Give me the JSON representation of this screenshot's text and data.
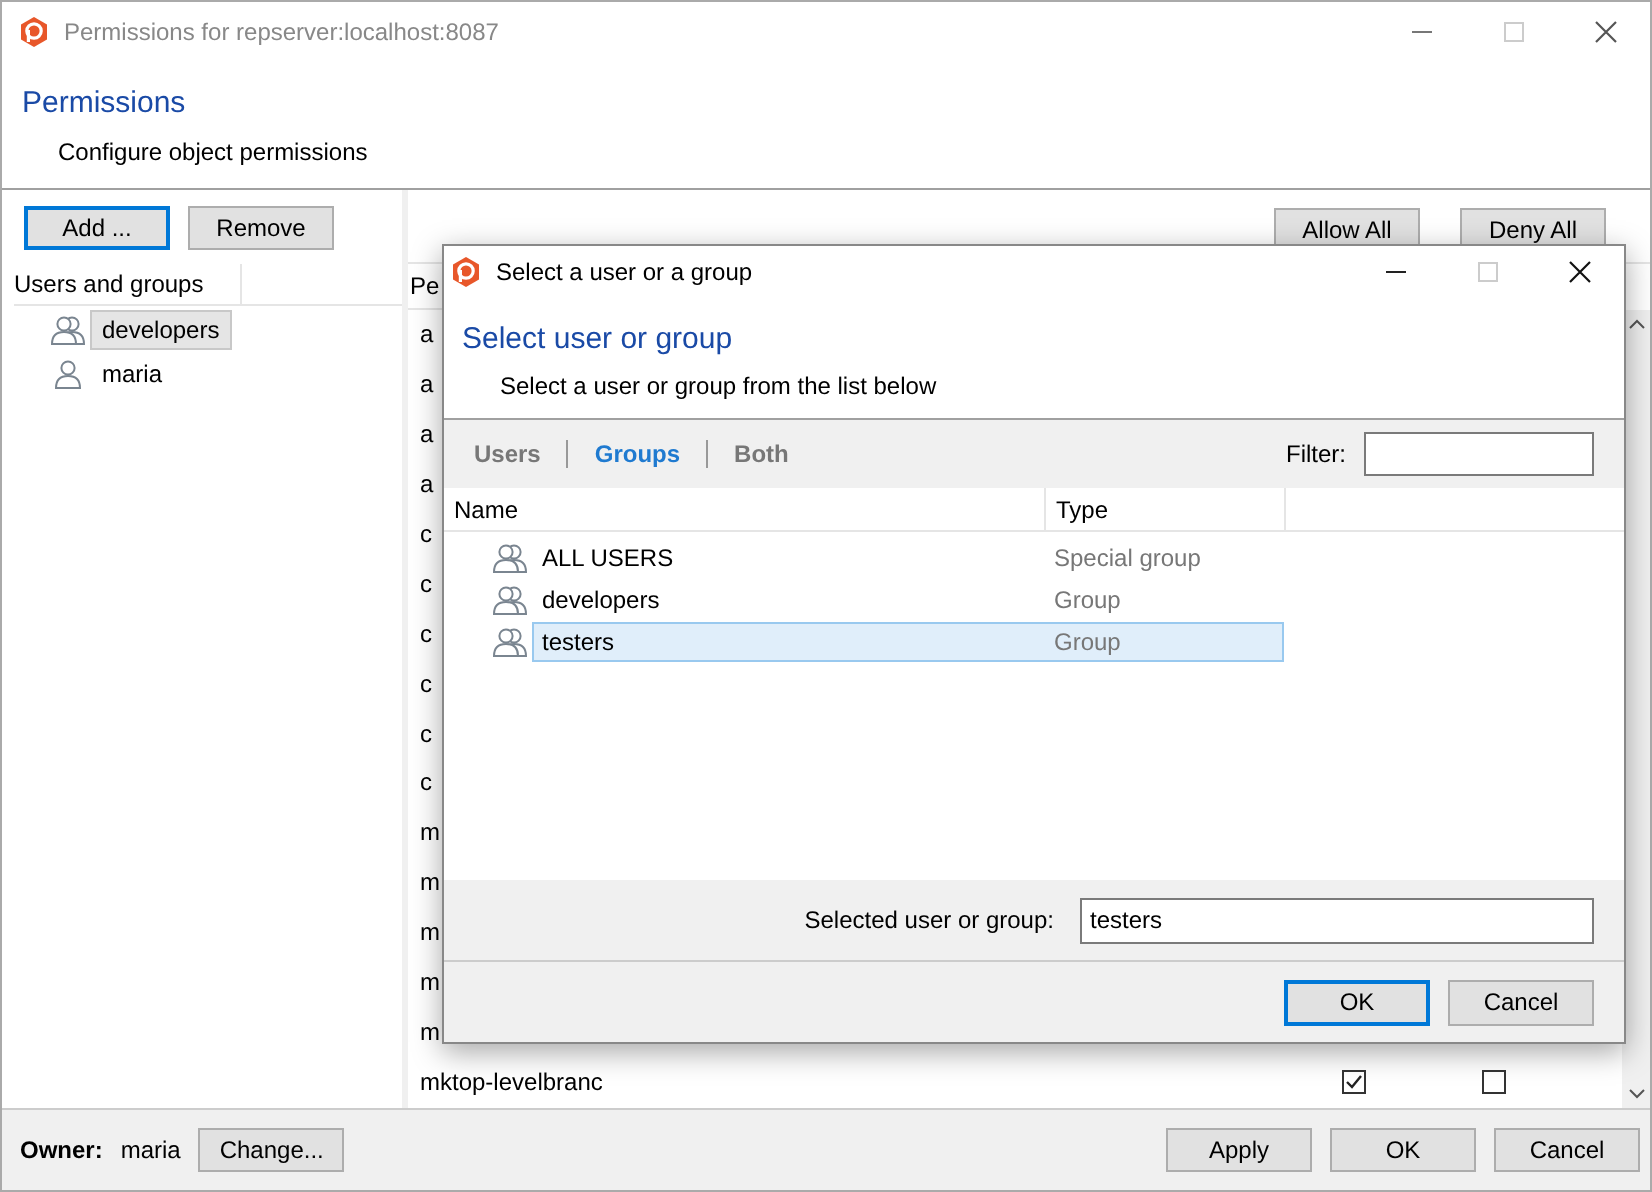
{
  "window": {
    "title": "Permissions for repserver:localhost:8087"
  },
  "header": {
    "title": "Permissions",
    "subtitle": "Configure object permissions"
  },
  "left_panel": {
    "buttons": [
      {
        "label": "Add ...",
        "focused": true
      },
      {
        "label": "Remove",
        "focused": false
      }
    ],
    "column": "Users and groups",
    "items": [
      {
        "name": "developers",
        "kind": "group",
        "selected": true
      },
      {
        "name": "maria",
        "kind": "user",
        "selected": false
      }
    ]
  },
  "right_panel": {
    "buttons": [
      "Allow All",
      "Deny All"
    ],
    "column": "Pe",
    "rows": [
      "a",
      "a",
      "a",
      "a",
      "c",
      "c",
      "c",
      "c",
      "c",
      "c",
      "m",
      "m",
      "m",
      "m",
      "m"
    ],
    "last_row": {
      "name": "mktop-levelbranc",
      "allow": true,
      "deny": false
    }
  },
  "owner": {
    "label": "Owner:",
    "value": "maria",
    "button": "Change..."
  },
  "footer_buttons": [
    "Apply",
    "OK",
    "Cancel"
  ],
  "dialog": {
    "title": "Select a user or a group",
    "header": {
      "title": "Select user or group",
      "subtitle": "Select a user or group from the list below"
    },
    "tabs": [
      {
        "label": "Users",
        "selected": false
      },
      {
        "label": "Groups",
        "selected": true
      },
      {
        "label": "Both",
        "selected": false
      }
    ],
    "filter_label": "Filter:",
    "columns": [
      "Name",
      "Type"
    ],
    "rows": [
      {
        "name": "ALL USERS",
        "type": "Special group",
        "selected": false
      },
      {
        "name": "developers",
        "type": "Group",
        "selected": false
      },
      {
        "name": "testers",
        "type": "Group",
        "selected": true
      }
    ],
    "selected_field": {
      "label": "Selected user or group:",
      "value": "testers"
    },
    "buttons": [
      {
        "label": "OK",
        "default": true
      },
      {
        "label": "Cancel",
        "default": false
      }
    ]
  }
}
